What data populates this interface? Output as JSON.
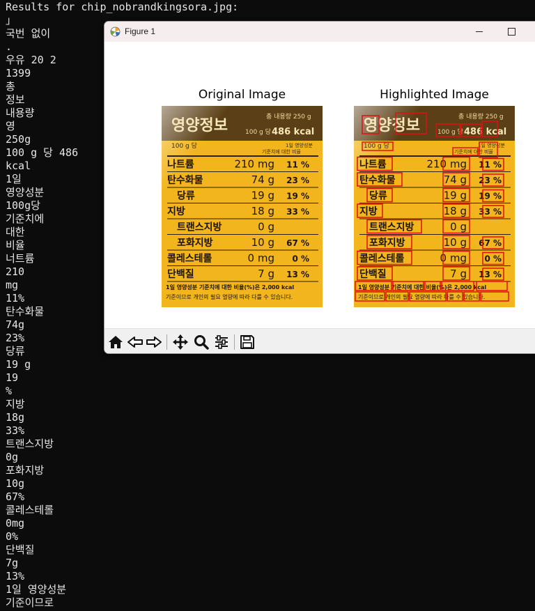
{
  "terminal": {
    "header": "Results for chip_nobrandkingsora.jpg:",
    "lines": [
      "」",
      "국번 없이",
      ".",
      "우유 20 2",
      "1399",
      "총",
      "정보",
      "내용량",
      "영",
      "250g",
      "100 g 당 486",
      "kcal",
      "1일",
      "영양성분",
      "100g당",
      "기준치에",
      "대한",
      "비율",
      "너트륨",
      "210",
      "mg",
      "11%",
      "탄수화물",
      "74g",
      "23%",
      "당류",
      "19 g",
      "19",
      "%",
      "지방",
      "18g",
      "33%",
      "트랜스지방",
      "0g",
      "포화지방",
      "10g",
      "67%",
      "콜레스테롤",
      "0mg",
      "0%",
      "단백질",
      "7g",
      "13%",
      "1일 영양성분",
      "기준이므로"
    ]
  },
  "figure": {
    "window_title": "Figure 1",
    "left_title": "Original Image",
    "right_title": "Highlighted Image",
    "box_color": "#e01010",
    "label": {
      "header": "영양정보",
      "total": "총 내용량 250 g",
      "per100": "100 g 당",
      "kcal": "486 kcal",
      "basis": "100 g 당",
      "daily_label_1": "1일 영양성분",
      "daily_label_2": "기준치에 대한 비율",
      "rows": [
        {
          "name": "나트륨",
          "amount": "210 mg",
          "pct": "11 %"
        },
        {
          "name": "탄수화물",
          "amount": "74 g",
          "pct": "23 %"
        },
        {
          "name": "당류",
          "amount": "19 g",
          "pct": "19 %"
        },
        {
          "name": "지방",
          "amount": "18 g",
          "pct": "33 %"
        },
        {
          "name": "트랜스지방",
          "amount": "0 g",
          "pct": ""
        },
        {
          "name": "포화지방",
          "amount": "10 g",
          "pct": "67 %"
        },
        {
          "name": "콜레스테롤",
          "amount": "0 mg",
          "pct": "0 %"
        },
        {
          "name": "단백질",
          "amount": "7 g",
          "pct": "13 %"
        }
      ],
      "footer_1": "1일 영양성분 기준치에 대한 비율(%)은 2,000 kcal",
      "footer_2": "기준이므로 개인의 필요 열량에 따라 다를 수 있습니다."
    },
    "toolbar": [
      "home-icon",
      "back-icon",
      "forward-icon",
      "pan-icon",
      "zoom-icon",
      "configure-subplots-icon",
      "save-icon"
    ]
  }
}
